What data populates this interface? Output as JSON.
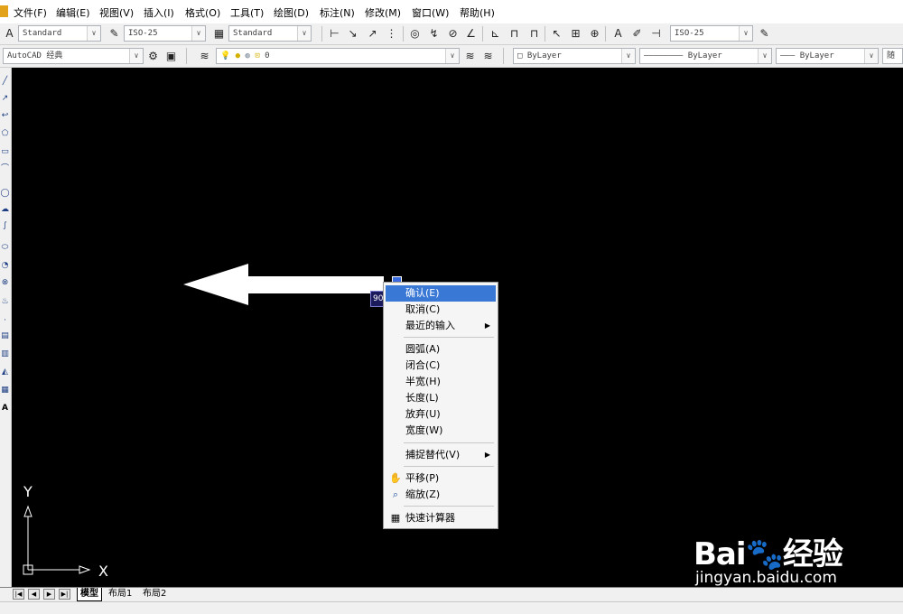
{
  "menubar": {
    "items": [
      "文件(F)",
      "编辑(E)",
      "视图(V)",
      "插入(I)",
      "格式(O)",
      "工具(T)",
      "绘图(D)",
      "标注(N)",
      "修改(M)",
      "窗口(W)",
      "帮助(H)"
    ]
  },
  "toolbar1": {
    "text_style": "Standard",
    "dim_style": "ISO-25",
    "table_style": "Standard",
    "dim_style_2": "ISO-25"
  },
  "toolbar2": {
    "workspace": "AutoCAD 经典",
    "layer": "0",
    "color": "ByLayer",
    "linetype": "ByLayer",
    "lineweight": "ByLayer",
    "plot_style": "随"
  },
  "canvas": {
    "ucs_y": "Y",
    "ucs_x": "X",
    "dynamic_input_value": "90"
  },
  "tabs": {
    "model": "模型",
    "layout1": "布局1",
    "layout2": "布局2"
  },
  "context_menu": {
    "confirm": "确认(E)",
    "cancel": "取消(C)",
    "recent_input": "最近的输入",
    "arc": "圆弧(A)",
    "close": "闭合(C)",
    "halfwidth": "半宽(H)",
    "length": "长度(L)",
    "undo": "放弃(U)",
    "width": "宽度(W)",
    "snap_override": "捕捉替代(V)",
    "pan": "平移(P)",
    "zoom": "缩放(Z)",
    "quickcalc": "快速计算器"
  },
  "watermark": {
    "brand": "Bai🐾经验",
    "url": "jingyan.baidu.com"
  },
  "colors": {
    "canvas": "#000000",
    "menu_highlight": "#3a78d6"
  }
}
